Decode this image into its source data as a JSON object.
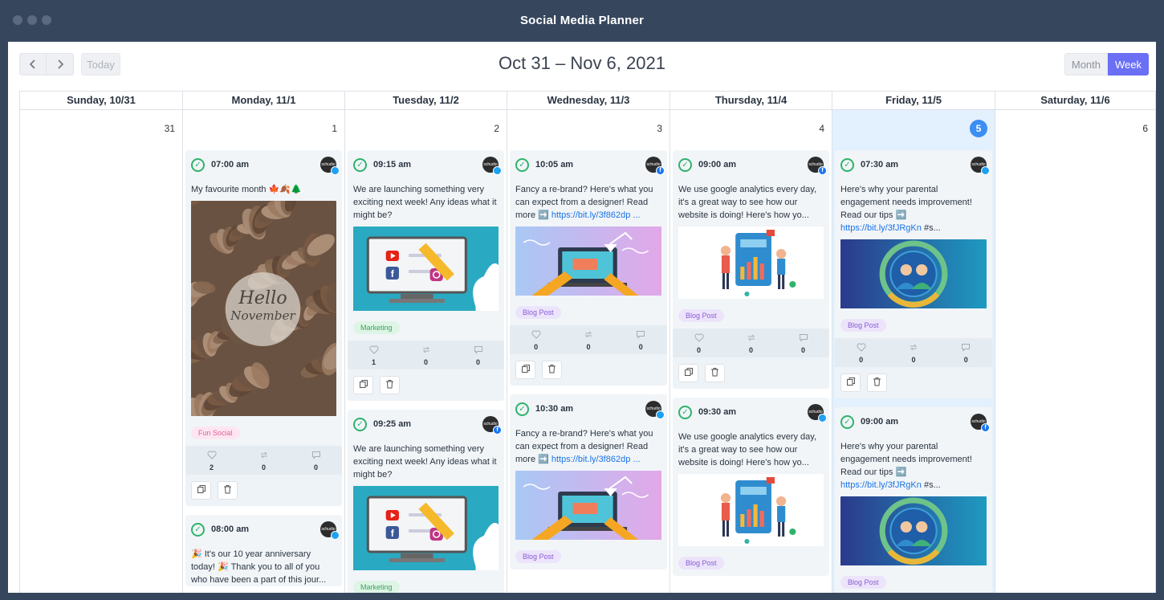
{
  "window": {
    "title": "Social Media Planner"
  },
  "toolbar": {
    "prev_icon": "chevron-left-icon",
    "next_icon": "chevron-right-icon",
    "today_label": "Today",
    "range_title": "Oct 31 – Nov 6, 2021",
    "views": [
      "Month",
      "Week"
    ],
    "active_view": "Week"
  },
  "colors": {
    "accent": "#6a6ff5",
    "today_bg": "#e3f0fd",
    "today_badge": "#3b8ef2",
    "titlebar": "#36465d",
    "check": "#2fb36a",
    "link": "#1a73e8"
  },
  "days": [
    {
      "header": "Sunday, 10/31",
      "num": "31",
      "today": false,
      "posts": []
    },
    {
      "header": "Monday, 11/1",
      "num": "1",
      "today": false,
      "posts": [
        {
          "time": "07:00 am",
          "network": "twitter",
          "avatar": "schudio",
          "text": "My favourite month 🍁🍂🌲",
          "link": "",
          "image": "hello-november",
          "image_caption": [
            "Hello",
            "November"
          ],
          "tag": "Fun Social",
          "tag_type": "fun",
          "likes": "2",
          "shares": "0",
          "comments": "0"
        },
        {
          "time": "08:00 am",
          "network": "twitter",
          "avatar": "schudio",
          "text": "🎉 It's our 10 year anniversary today! 🎉 Thank you to all of you who have been a part of this jour...",
          "link": "",
          "image": "",
          "tag": "",
          "tag_type": "",
          "likes": "",
          "shares": "",
          "comments": ""
        }
      ]
    },
    {
      "header": "Tuesday, 11/2",
      "num": "2",
      "today": false,
      "posts": [
        {
          "time": "09:15 am",
          "network": "twitter",
          "avatar": "schudio",
          "text": "We are launching something very exciting next week! Any ideas what it might be?",
          "link": "",
          "image": "monitor-social",
          "tag": "Marketing",
          "tag_type": "mkt",
          "likes": "1",
          "shares": "0",
          "comments": "0"
        },
        {
          "time": "09:25 am",
          "network": "facebook",
          "avatar": "schudio",
          "text": "We are launching something very exciting next week! Any ideas what it might be?",
          "link": "",
          "image": "monitor-social",
          "tag": "Marketing",
          "tag_type": "mkt",
          "likes": "",
          "shares": "",
          "comments": ""
        }
      ]
    },
    {
      "header": "Wednesday, 11/3",
      "num": "3",
      "today": false,
      "posts": [
        {
          "time": "10:05 am",
          "network": "facebook",
          "avatar": "schudio",
          "text": "Fancy a re-brand? Here's what you can expect from a designer! Read more ➡️ ",
          "link": "https://bit.ly/3f862dp ...",
          "image": "designer-laptop",
          "tag": "Blog Post",
          "tag_type": "blog",
          "likes": "0",
          "shares": "0",
          "comments": "0"
        },
        {
          "time": "10:30 am",
          "network": "twitter",
          "avatar": "schudio",
          "text": "Fancy a re-brand? Here's what you can expect from a designer! Read more ➡️ ",
          "link": "https://bit.ly/3f862dp ...",
          "image": "designer-laptop",
          "tag": "Blog Post",
          "tag_type": "blog",
          "likes": "",
          "shares": "",
          "comments": ""
        }
      ]
    },
    {
      "header": "Thursday, 11/4",
      "num": "4",
      "today": false,
      "posts": [
        {
          "time": "09:00 am",
          "network": "facebook",
          "avatar": "schudio",
          "text": "We use google analytics every day, it's a great way to see how our website is doing! Here's how yo...",
          "link": "",
          "image": "analytics-people",
          "tag": "Blog Post",
          "tag_type": "blog",
          "likes": "0",
          "shares": "0",
          "comments": "0"
        },
        {
          "time": "09:30 am",
          "network": "twitter",
          "avatar": "schudio",
          "text": "We use google analytics every day, it's a great way to see how our website is doing! Here's how yo...",
          "link": "",
          "image": "analytics-people",
          "tag": "Blog Post",
          "tag_type": "blog",
          "likes": "",
          "shares": "",
          "comments": ""
        }
      ]
    },
    {
      "header": "Friday, 11/5",
      "num": "5",
      "today": true,
      "posts": [
        {
          "time": "07:30 am",
          "network": "twitter",
          "avatar": "schudio",
          "text": "Here's why your parental engagement needs improvement! Read our tips ➡️ ",
          "link": "https://bit.ly/3fJRgKn",
          "link_suffix": " #s...",
          "image": "engagement-circle",
          "tag": "Blog Post",
          "tag_type": "blog",
          "likes": "0",
          "shares": "0",
          "comments": "0"
        },
        {
          "time": "09:00 am",
          "network": "facebook",
          "avatar": "schudio",
          "text": "Here's why your parental engagement needs improvement! Read our tips ➡️ ",
          "link": "https://bit.ly/3fJRgKn",
          "link_suffix": " #s...",
          "image": "engagement-circle",
          "tag": "Blog Post",
          "tag_type": "blog",
          "likes": "",
          "shares": "",
          "comments": ""
        }
      ]
    },
    {
      "header": "Saturday, 11/6",
      "num": "6",
      "today": false,
      "posts": []
    }
  ]
}
